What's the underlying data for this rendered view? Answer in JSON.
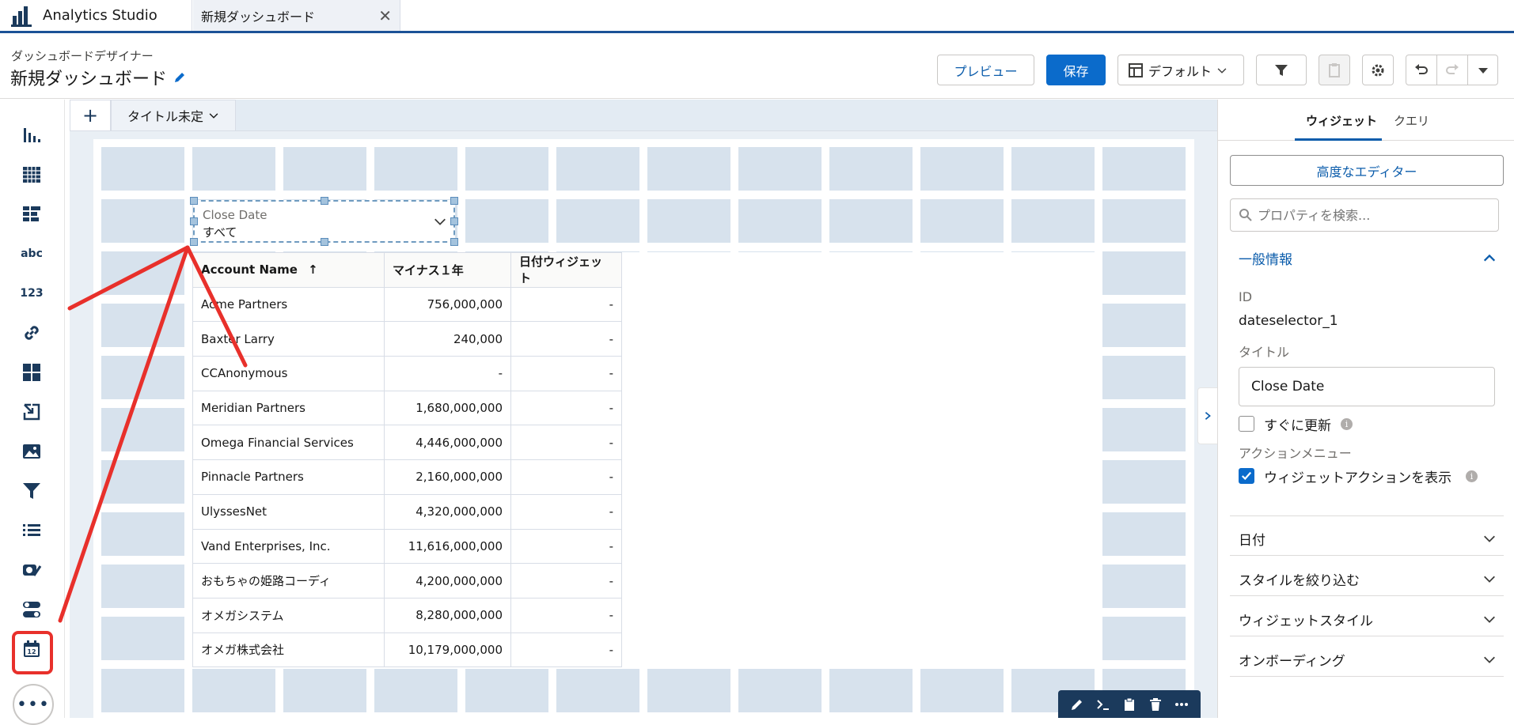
{
  "app": {
    "title": "Analytics Studio"
  },
  "doc_tab": {
    "label": "新規ダッシュボード",
    "close": "✕"
  },
  "header": {
    "subtitle": "ダッシュボードデザイナー",
    "title": "新規ダッシュボード",
    "preview_label": "プレビュー",
    "save_label": "保存",
    "layout_label": "デフォルト"
  },
  "left_toolbar": {
    "items": [
      "bar-chart-icon",
      "table-icon",
      "compare-table-icon",
      "text-icon",
      "number-icon",
      "link-icon",
      "container-icon",
      "navigation-icon",
      "image-icon",
      "filter-icon",
      "list-selector-icon",
      "yoy-icon",
      "toggle-icon",
      "date-icon"
    ],
    "text_label": "abc",
    "number_label": "123",
    "more": "•••"
  },
  "page_tabs": {
    "add": "+",
    "current": "タイトル未定"
  },
  "date_selector": {
    "label": "Close Date",
    "value": "すべて"
  },
  "table": {
    "columns": [
      "Account Name",
      "マイナス１年",
      "日付ウィジェット"
    ],
    "sort_indicator": "↑",
    "rows": [
      [
        "Acme Partners",
        "756,000,000",
        "-"
      ],
      [
        "Baxter Larry",
        "240,000",
        "-"
      ],
      [
        "CCAnonymous",
        "-",
        "-"
      ],
      [
        "Meridian Partners",
        "1,680,000,000",
        "-"
      ],
      [
        "Omega Financial Services",
        "4,446,000,000",
        "-"
      ],
      [
        "Pinnacle Partners",
        "2,160,000,000",
        "-"
      ],
      [
        "UlyssesNet",
        "4,320,000,000",
        "-"
      ],
      [
        "Vand Enterprises, Inc.",
        "11,616,000,000",
        "-"
      ],
      [
        "おもちゃの姫路コーディ",
        "4,200,000,000",
        "-"
      ],
      [
        "オメガシステム",
        "8,280,000,000",
        "-"
      ],
      [
        "オメガ株式会社",
        "10,179,000,000",
        "-"
      ]
    ]
  },
  "right_panel": {
    "tabs": [
      "ウィジェット",
      "クエリ"
    ],
    "advanced_editor": "高度なエディター",
    "search_placeholder": "プロパティを検索...",
    "general_section": "一般情報",
    "id_label": "ID",
    "id_value": "dateselector_1",
    "title_label": "タイトル",
    "title_value": "Close Date",
    "update_now": "すぐに更新",
    "action_menu_label": "アクションメニュー",
    "show_actions": "ウィジェットアクションを表示",
    "sections": [
      "日付",
      "スタイルを絞り込む",
      "ウィジェットスタイル",
      "オンボーディング"
    ]
  },
  "colors": {
    "accent": "#0b6bcb",
    "header_border": "#1b5297",
    "annotation": "#e8302b",
    "grid_cell": "#d7e2ed"
  }
}
